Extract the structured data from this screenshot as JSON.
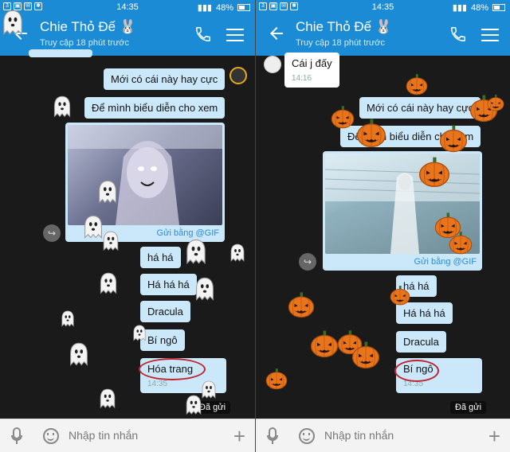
{
  "status": {
    "time": "14:35",
    "battery": "48%"
  },
  "header": {
    "title": "Chie Thỏ Đế",
    "bunny": "🐰",
    "subtitle": "Truy cập 18 phút trước"
  },
  "left": {
    "messages": [
      "Mới có cái này hay cực",
      "Để mình biểu diễn cho xem",
      "há há",
      "Há há há",
      "Dracula",
      "Bí ngô",
      "Hóa trang"
    ],
    "gif_caption": "Gửi bằng @GIF",
    "timestamp": "14:35",
    "sent_status": "Đã gửi"
  },
  "right": {
    "incoming": {
      "text": "Cái j đấy",
      "time": "14:16"
    },
    "messages": [
      "Mới có cái này hay cực",
      "Để mình biểu diễn cho xem",
      "há há",
      "Há há há",
      "Dracula",
      "Bí ngô"
    ],
    "gif_caption": "Gửi bằng @GIF",
    "timestamp": "14:35",
    "sent_status": "Đã gửi"
  },
  "composer": {
    "placeholder": "Nhập tin nhắn"
  },
  "colors": {
    "header": "#1a8bd4",
    "bubble": "#cbe8fb",
    "highlight": "#c0232b"
  }
}
